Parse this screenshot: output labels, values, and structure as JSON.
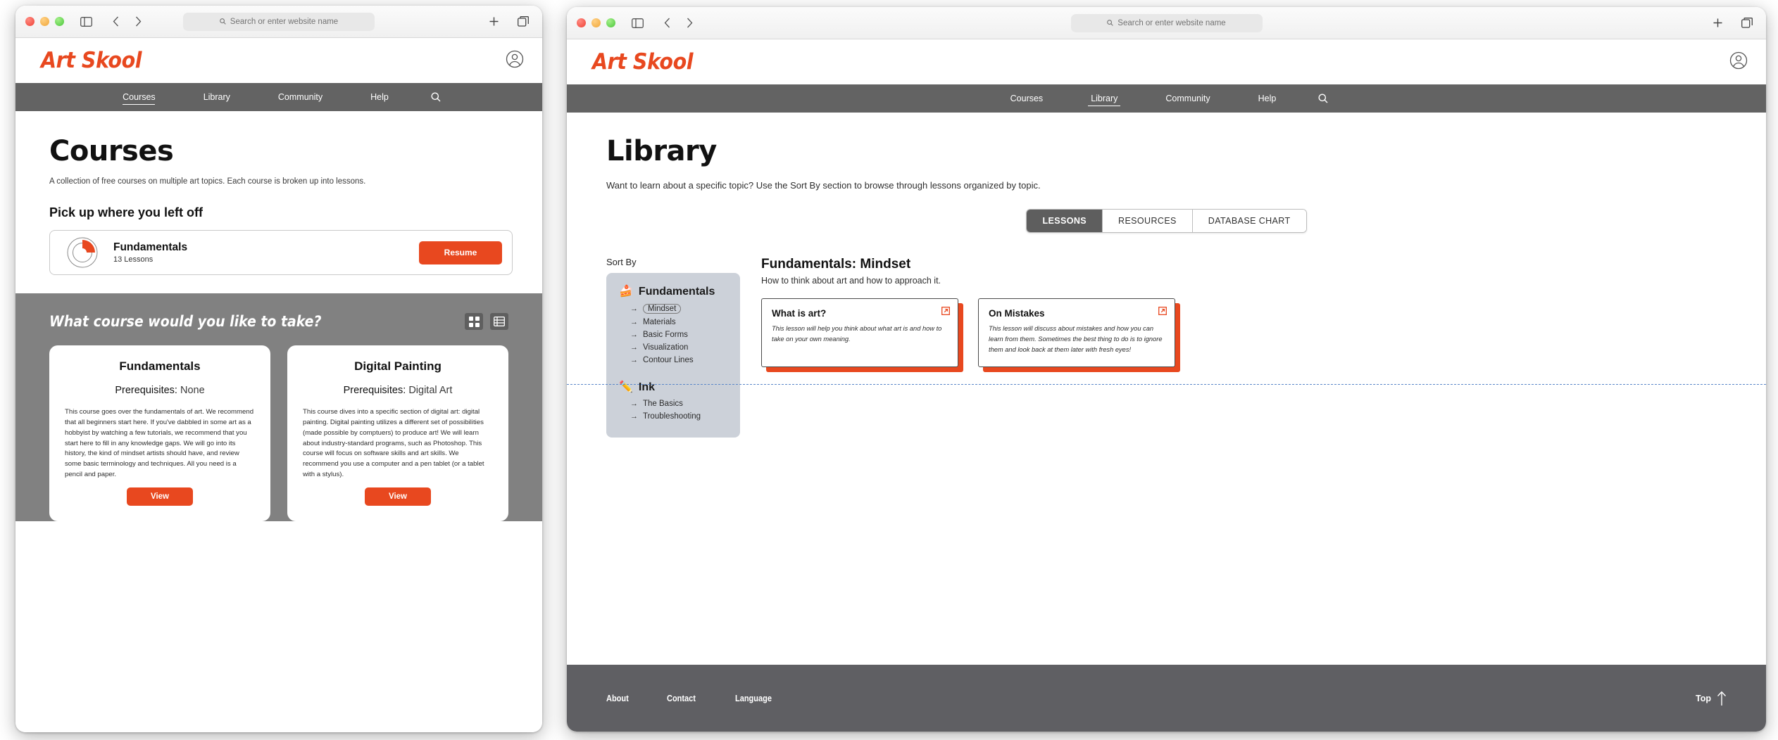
{
  "browser": {
    "search_placeholder": "Search or enter website name",
    "icons": {
      "sidebar": "sidebar-toggle-icon",
      "back": "back-arrow-icon",
      "forward": "forward-arrow-icon",
      "search": "search-icon",
      "new_tab": "plus-icon",
      "tabs": "tab-overview-icon"
    }
  },
  "site": {
    "brand": "Art Skool",
    "nav": [
      {
        "label": "Courses"
      },
      {
        "label": "Library"
      },
      {
        "label": "Community"
      },
      {
        "label": "Help"
      }
    ]
  },
  "courses_page": {
    "active_nav": "Courses",
    "title": "Courses",
    "lede": "A collection of free courses on multiple art topics. Each course is broken up into lessons.",
    "pickup_heading": "Pick up where you left off",
    "resume": {
      "course": "Fundamentals",
      "lessons": "13 Lessons",
      "button": "Resume",
      "progress_percent": 25,
      "progress_color": "#e8481f"
    },
    "gray_heading": "What course would you like to take?",
    "view_modes": [
      {
        "name": "grid-view",
        "active": true
      },
      {
        "name": "list-view",
        "active": false
      }
    ],
    "cards": [
      {
        "title": "Fundamentals",
        "prereq_label": "Prerequisites:",
        "prereq_value": "None",
        "body": "This course goes over the fundamentals of art. We recommend that all beginners start here. If you've dabbled in some art as a hobbyist by watching a few tutorials, we recommend that you start here to fill in any knowledge gaps. We will go into its history, the kind of mindset artists should have, and review some basic terminology and techniques. All you need is a pencil and paper.",
        "button": "View"
      },
      {
        "title": "Digital Painting",
        "prereq_label": "Prerequisites:",
        "prereq_value": "Digital Art",
        "body": "This course dives into a specific section of digital art: digital painting. Digital painting utilizes a different set of possibilities (made possible by comptuers) to produce art! We will learn about industry-standard programs, such as Photoshop. This course will focus on software skills and art skills. We recommend you use a computer and a pen tablet (or a tablet with a stylus).",
        "button": "View"
      }
    ]
  },
  "library_page": {
    "active_nav": "Library",
    "title": "Library",
    "lede": "Want to learn about a specific topic? Use the Sort By section to browse through lessons organized by topic.",
    "tabs": [
      {
        "label": "LESSONS",
        "active": true
      },
      {
        "label": "RESOURCES",
        "active": false
      },
      {
        "label": "DATABASE CHART",
        "active": false
      }
    ],
    "sort_by_label": "Sort By",
    "groups": [
      {
        "name": "Fundamentals",
        "emoji": "🍰",
        "icon_name": "cake-icon",
        "items": [
          {
            "label": "Mindset",
            "selected": true
          },
          {
            "label": "Materials",
            "selected": false
          },
          {
            "label": "Basic Forms",
            "selected": false
          },
          {
            "label": "Visualization",
            "selected": false
          },
          {
            "label": "Contour Lines",
            "selected": false
          }
        ]
      },
      {
        "name": "Ink",
        "emoji": "✏️",
        "icon_name": "pencil-icon",
        "items": [
          {
            "label": "The Basics",
            "selected": false
          },
          {
            "label": "Troubleshooting",
            "selected": false
          }
        ]
      }
    ],
    "lessons_heading": "Fundamentals: Mindset",
    "lessons_sub": "How to think about art and how to approach it.",
    "lessons": [
      {
        "title": "What is art?",
        "desc": "This lesson will help you think about what art is and how to take on your own meaning."
      },
      {
        "title": "On Mistakes",
        "desc": "This lesson will discuss about mistakes and how you can learn from them. Sometimes the best thing to do is to ignore them and look back at them later with fresh eyes!"
      }
    ],
    "footer": {
      "links": [
        {
          "label": "About"
        },
        {
          "label": "Contact"
        },
        {
          "label": "Language"
        }
      ],
      "top_label": "Top"
    }
  },
  "colors": {
    "accent": "#e8481f",
    "nav_gray": "#636363",
    "section_gray": "#818181",
    "footer_gray": "#5f5f63",
    "sidebar_blue_gray": "#ccd1d9",
    "dashed_blue": "#5b87c9"
  }
}
